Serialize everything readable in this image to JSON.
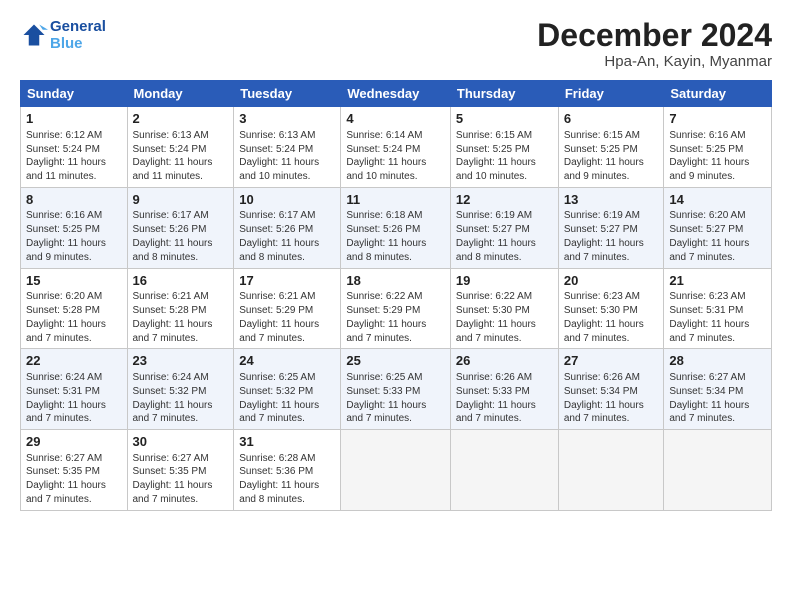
{
  "header": {
    "logo_line1": "General",
    "logo_line2": "Blue",
    "month": "December 2024",
    "location": "Hpa-An, Kayin, Myanmar"
  },
  "weekdays": [
    "Sunday",
    "Monday",
    "Tuesday",
    "Wednesday",
    "Thursday",
    "Friday",
    "Saturday"
  ],
  "weeks": [
    [
      {
        "day": "1",
        "info": "Sunrise: 6:12 AM\nSunset: 5:24 PM\nDaylight: 11 hours\nand 11 minutes."
      },
      {
        "day": "2",
        "info": "Sunrise: 6:13 AM\nSunset: 5:24 PM\nDaylight: 11 hours\nand 11 minutes."
      },
      {
        "day": "3",
        "info": "Sunrise: 6:13 AM\nSunset: 5:24 PM\nDaylight: 11 hours\nand 10 minutes."
      },
      {
        "day": "4",
        "info": "Sunrise: 6:14 AM\nSunset: 5:24 PM\nDaylight: 11 hours\nand 10 minutes."
      },
      {
        "day": "5",
        "info": "Sunrise: 6:15 AM\nSunset: 5:25 PM\nDaylight: 11 hours\nand 10 minutes."
      },
      {
        "day": "6",
        "info": "Sunrise: 6:15 AM\nSunset: 5:25 PM\nDaylight: 11 hours\nand 9 minutes."
      },
      {
        "day": "7",
        "info": "Sunrise: 6:16 AM\nSunset: 5:25 PM\nDaylight: 11 hours\nand 9 minutes."
      }
    ],
    [
      {
        "day": "8",
        "info": "Sunrise: 6:16 AM\nSunset: 5:25 PM\nDaylight: 11 hours\nand 9 minutes."
      },
      {
        "day": "9",
        "info": "Sunrise: 6:17 AM\nSunset: 5:26 PM\nDaylight: 11 hours\nand 8 minutes."
      },
      {
        "day": "10",
        "info": "Sunrise: 6:17 AM\nSunset: 5:26 PM\nDaylight: 11 hours\nand 8 minutes."
      },
      {
        "day": "11",
        "info": "Sunrise: 6:18 AM\nSunset: 5:26 PM\nDaylight: 11 hours\nand 8 minutes."
      },
      {
        "day": "12",
        "info": "Sunrise: 6:19 AM\nSunset: 5:27 PM\nDaylight: 11 hours\nand 8 minutes."
      },
      {
        "day": "13",
        "info": "Sunrise: 6:19 AM\nSunset: 5:27 PM\nDaylight: 11 hours\nand 7 minutes."
      },
      {
        "day": "14",
        "info": "Sunrise: 6:20 AM\nSunset: 5:27 PM\nDaylight: 11 hours\nand 7 minutes."
      }
    ],
    [
      {
        "day": "15",
        "info": "Sunrise: 6:20 AM\nSunset: 5:28 PM\nDaylight: 11 hours\nand 7 minutes."
      },
      {
        "day": "16",
        "info": "Sunrise: 6:21 AM\nSunset: 5:28 PM\nDaylight: 11 hours\nand 7 minutes."
      },
      {
        "day": "17",
        "info": "Sunrise: 6:21 AM\nSunset: 5:29 PM\nDaylight: 11 hours\nand 7 minutes."
      },
      {
        "day": "18",
        "info": "Sunrise: 6:22 AM\nSunset: 5:29 PM\nDaylight: 11 hours\nand 7 minutes."
      },
      {
        "day": "19",
        "info": "Sunrise: 6:22 AM\nSunset: 5:30 PM\nDaylight: 11 hours\nand 7 minutes."
      },
      {
        "day": "20",
        "info": "Sunrise: 6:23 AM\nSunset: 5:30 PM\nDaylight: 11 hours\nand 7 minutes."
      },
      {
        "day": "21",
        "info": "Sunrise: 6:23 AM\nSunset: 5:31 PM\nDaylight: 11 hours\nand 7 minutes."
      }
    ],
    [
      {
        "day": "22",
        "info": "Sunrise: 6:24 AM\nSunset: 5:31 PM\nDaylight: 11 hours\nand 7 minutes."
      },
      {
        "day": "23",
        "info": "Sunrise: 6:24 AM\nSunset: 5:32 PM\nDaylight: 11 hours\nand 7 minutes."
      },
      {
        "day": "24",
        "info": "Sunrise: 6:25 AM\nSunset: 5:32 PM\nDaylight: 11 hours\nand 7 minutes."
      },
      {
        "day": "25",
        "info": "Sunrise: 6:25 AM\nSunset: 5:33 PM\nDaylight: 11 hours\nand 7 minutes."
      },
      {
        "day": "26",
        "info": "Sunrise: 6:26 AM\nSunset: 5:33 PM\nDaylight: 11 hours\nand 7 minutes."
      },
      {
        "day": "27",
        "info": "Sunrise: 6:26 AM\nSunset: 5:34 PM\nDaylight: 11 hours\nand 7 minutes."
      },
      {
        "day": "28",
        "info": "Sunrise: 6:27 AM\nSunset: 5:34 PM\nDaylight: 11 hours\nand 7 minutes."
      }
    ],
    [
      {
        "day": "29",
        "info": "Sunrise: 6:27 AM\nSunset: 5:35 PM\nDaylight: 11 hours\nand 7 minutes."
      },
      {
        "day": "30",
        "info": "Sunrise: 6:27 AM\nSunset: 5:35 PM\nDaylight: 11 hours\nand 7 minutes."
      },
      {
        "day": "31",
        "info": "Sunrise: 6:28 AM\nSunset: 5:36 PM\nDaylight: 11 hours\nand 8 minutes."
      },
      {
        "day": "",
        "info": ""
      },
      {
        "day": "",
        "info": ""
      },
      {
        "day": "",
        "info": ""
      },
      {
        "day": "",
        "info": ""
      }
    ]
  ]
}
